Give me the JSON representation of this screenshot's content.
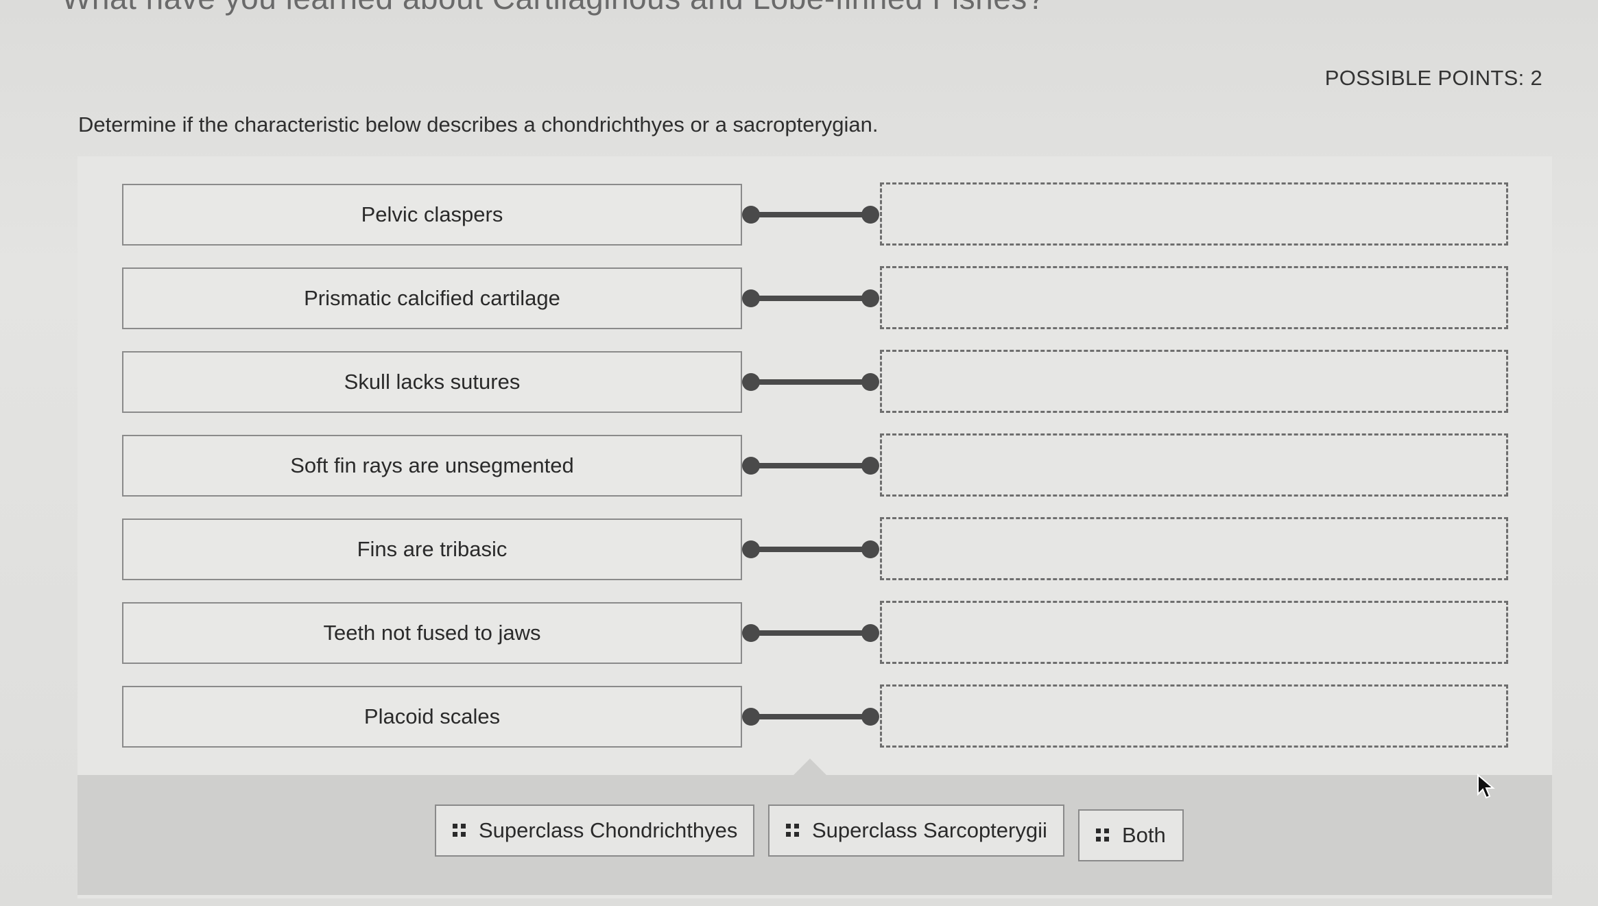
{
  "header": {
    "title_partial": "What have you learned about Cartilaginous and Lobe-finned Fishes?",
    "possible_points": "POSSIBLE POINTS: 2"
  },
  "question": {
    "instructions": "Determine if the characteristic below describes a chondrichthyes or a sacropterygian."
  },
  "terms": [
    {
      "label": "Pelvic claspers"
    },
    {
      "label": "Prismatic calcified cartilage"
    },
    {
      "label": "Skull lacks sutures"
    },
    {
      "label": "Soft fin rays are unsegmented"
    },
    {
      "label": "Fins are tribasic"
    },
    {
      "label": "Teeth not fused to jaws"
    },
    {
      "label": "Placoid scales"
    }
  ],
  "answer_bank": [
    {
      "label": "Superclass Chondrichthyes",
      "icon": "drag-grip-icon"
    },
    {
      "label": "Superclass Sarcopterygii",
      "icon": "drag-grip-icon"
    },
    {
      "label": "Both",
      "icon": "drag-grip-icon"
    }
  ],
  "colors": {
    "connector": "#4a4a4a",
    "panel": "#e6e6e4",
    "bank": "#cfcfcd"
  }
}
